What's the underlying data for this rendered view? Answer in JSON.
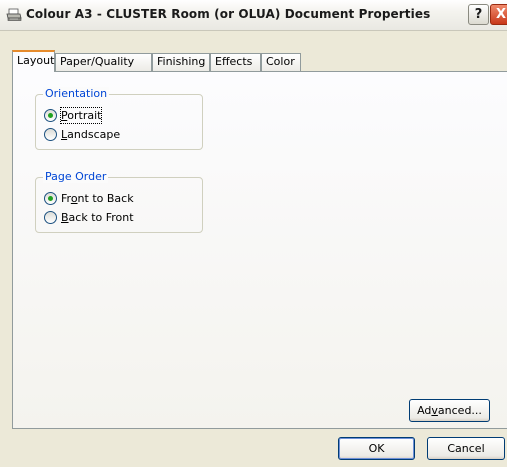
{
  "window": {
    "title": "Colour A3 - CLUSTER Room (or OLUA) Document Properties",
    "title_icon": "printer-icon",
    "help_glyph": "?",
    "close_glyph": "X"
  },
  "tabs": [
    {
      "label": "Layout",
      "active": true
    },
    {
      "label": "Paper/Quality",
      "active": false
    },
    {
      "label": "Finishing",
      "active": false
    },
    {
      "label": "Effects",
      "active": false
    },
    {
      "label": "Color",
      "active": false
    }
  ],
  "orientation": {
    "legend": "Orientation",
    "options": [
      {
        "pre": "",
        "ul": "P",
        "post": "ortrait",
        "selected": true
      },
      {
        "pre": "",
        "ul": "L",
        "post": "andscape",
        "selected": false
      }
    ]
  },
  "page_order": {
    "legend": "Page Order",
    "options": [
      {
        "pre": "Fr",
        "ul": "o",
        "post": "nt to Back",
        "selected": true
      },
      {
        "pre": "",
        "ul": "B",
        "post": "ack to Front",
        "selected": false
      }
    ]
  },
  "buttons": {
    "advanced": {
      "pre": "Ad",
      "ul": "v",
      "post": "anced..."
    },
    "ok": "OK",
    "cancel": "Cancel"
  },
  "colors": {
    "group_label": "#0046d5",
    "radio_selected": "#21a121",
    "active_tab_accent": "#e68b2c"
  }
}
